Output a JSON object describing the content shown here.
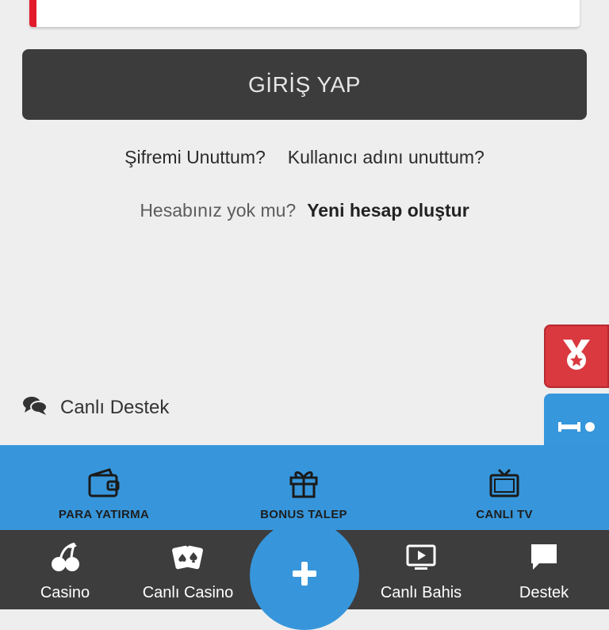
{
  "login": {
    "button_label": "GİRİŞ YAP",
    "forgot_password": "Şifremi Unuttum?",
    "forgot_username": "Kullanıcı adını unuttum?",
    "no_account_question": "Hesabınız yok mu?",
    "create_account": "Yeni hesap oluştur"
  },
  "support": {
    "live_label": "Canlı Destek"
  },
  "quick_actions": [
    {
      "label": "PARA YATIRMA",
      "icon": "wallet-icon"
    },
    {
      "label": "BONUS TALEP",
      "icon": "gift-icon"
    },
    {
      "label": "CANLI TV",
      "icon": "tv-icon"
    }
  ],
  "bottom_nav": [
    {
      "label": "Casino",
      "icon": "cherries-icon"
    },
    {
      "label": "Canlı Casino",
      "icon": "playing-cards-icon"
    },
    {
      "label": "Canlı Bahis",
      "icon": "play-screen-icon"
    },
    {
      "label": "Destek",
      "icon": "chat-bubble-icon"
    }
  ],
  "side_badges": [
    {
      "icon": "medal-icon",
      "color": "#d9393f"
    },
    {
      "icon": "sport-icon",
      "color": "#3797dd"
    }
  ],
  "colors": {
    "accent_red": "#e21a2c",
    "primary_blue": "#3796db",
    "dark": "#3d3d3d"
  }
}
